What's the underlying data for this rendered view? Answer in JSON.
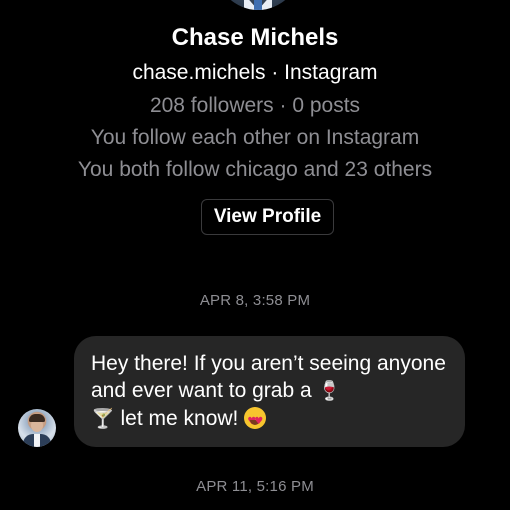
{
  "profile": {
    "name": "Chase Michels",
    "handle_line": "chase.michels · Instagram",
    "stats_line": "208 followers · 0 posts",
    "mutual_follow": "You follow each other on Instagram",
    "mutual_accounts": "You both follow chicago and 23 others",
    "view_profile_label": "View Profile"
  },
  "conversation": {
    "timestamps": [
      "APR 8, 3:58 PM",
      "APR 11, 5:16 PM"
    ],
    "messages": [
      {
        "text_part1": "Hey there! If you aren’t seeing anyone and ever want to grab a ",
        "emoji_1": "🍷",
        "text_part2": " ",
        "emoji_2": "🍸",
        "text_part3": " let me know! ",
        "emoji_3": "😍"
      }
    ]
  },
  "colors": {
    "background": "#000000",
    "primary_text": "#ffffff",
    "secondary_text": "#8e8e93",
    "bubble_background": "#262626",
    "button_border": "#3a3a3c"
  },
  "icons": {
    "emoji_1": "wine-glass-icon",
    "emoji_2": "cocktail-glass-icon",
    "emoji_3": "heart-eyes-icon"
  }
}
